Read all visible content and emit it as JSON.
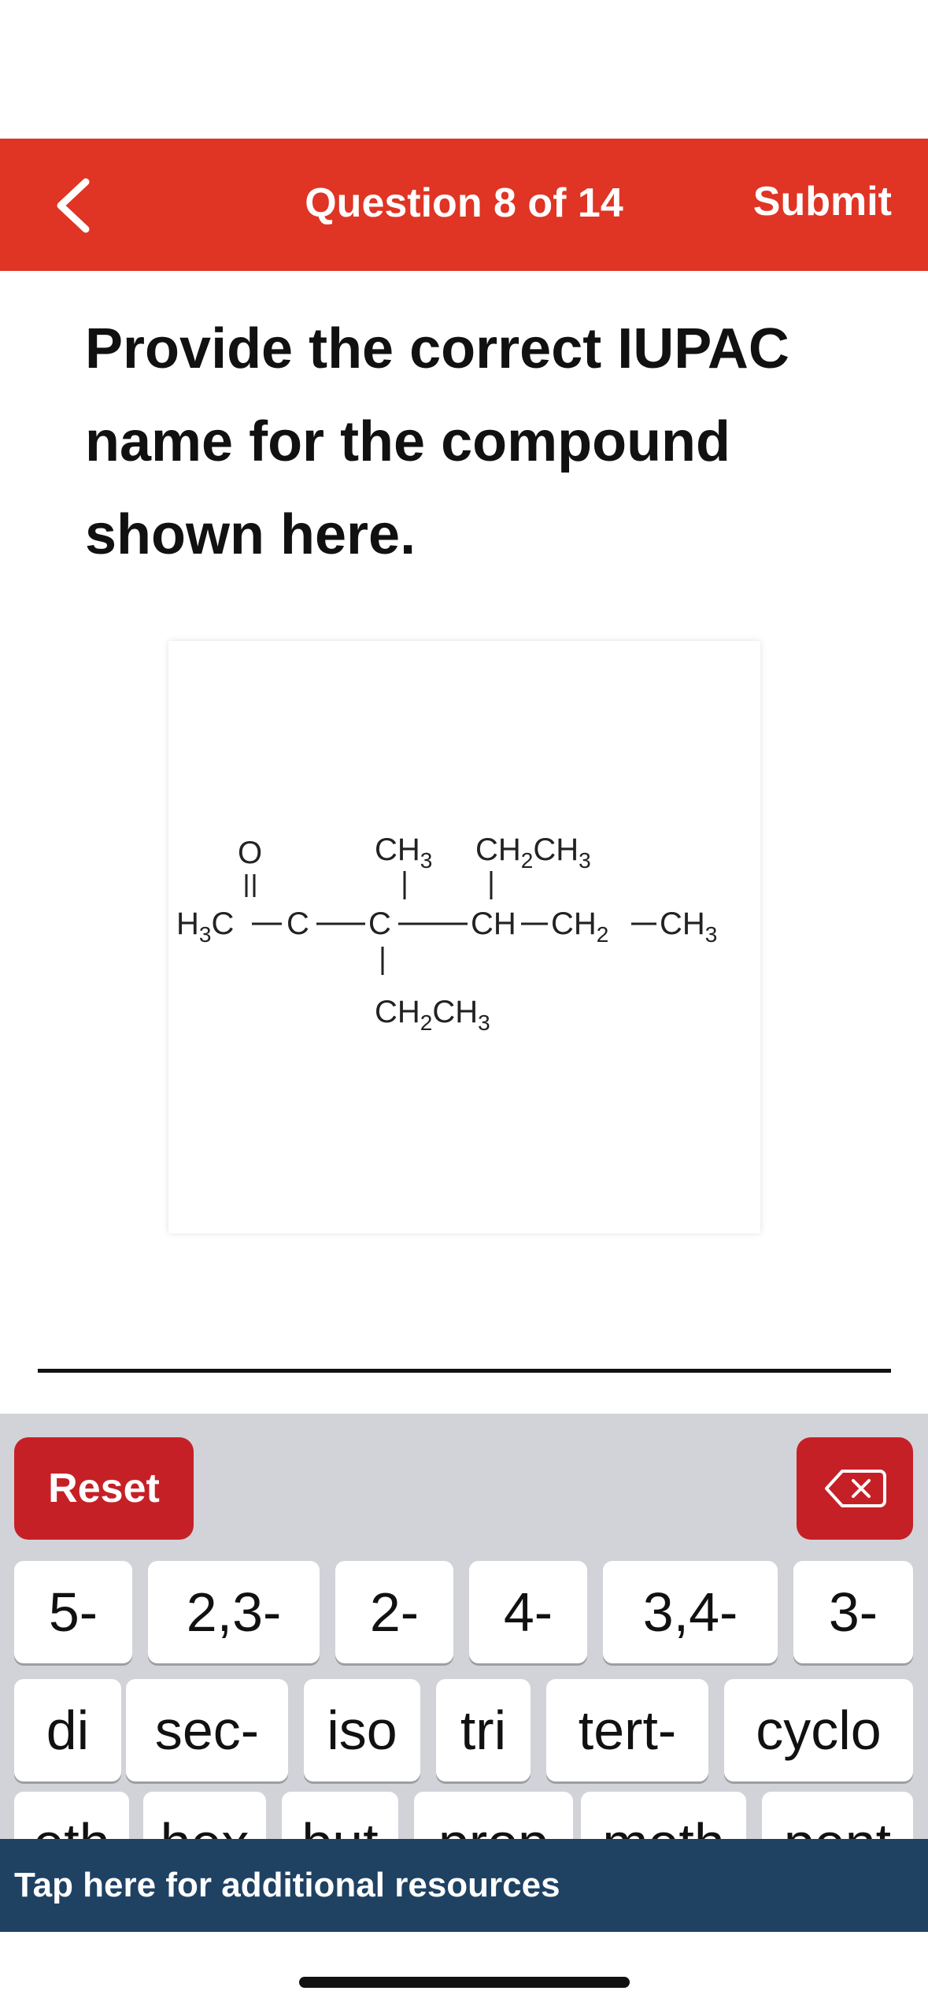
{
  "header": {
    "title": "Question 8 of 14",
    "submit_label": "Submit"
  },
  "question": {
    "text": "Provide the correct IUPAC name for the compound shown here."
  },
  "structure": {
    "o": "O",
    "ch3": "CH",
    "ch2ch3": "CH",
    "h3c": "H",
    "c": "C",
    "ch": "CH",
    "ch2": "CH",
    "subscript_2": "2",
    "subscript_3": "3"
  },
  "keyboard": {
    "reset_label": "Reset",
    "rows": [
      [
        "5-",
        "2,3-",
        "2-",
        "4-",
        "3,4-",
        "3-"
      ],
      [
        "di",
        "sec-",
        "iso",
        "tri",
        "tert-",
        "cyclo"
      ],
      [
        "eth",
        "hex",
        "but",
        "prop",
        "meth",
        "pent"
      ]
    ]
  },
  "resources": {
    "label": "Tap here for additional resources"
  },
  "colors": {
    "header": "#e03424",
    "key_red": "#c62027",
    "resources_bar": "#1f4263",
    "keyboard_bg": "#d1d3d9"
  }
}
